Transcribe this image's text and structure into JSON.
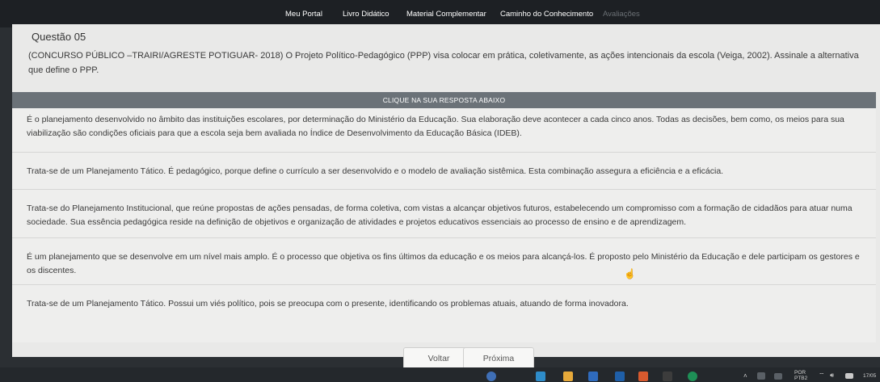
{
  "nav": {
    "items": [
      {
        "label": "Meu Portal"
      },
      {
        "label": "Livro Didático"
      },
      {
        "label": "Material Complementar"
      },
      {
        "label": "Caminho do Conhecimento"
      },
      {
        "label": "Avaliações"
      }
    ]
  },
  "question": {
    "title": "Questão 05",
    "text": "(CONCURSO PÚBLICO –TRAIRI/AGRESTE POTIGUAR- 2018) O Projeto Político-Pedagógico (PPP) visa colocar em prática, coletivamente, as ações intencionais da escola (Veiga, 2002). Assinale a alternativa que define o PPP."
  },
  "answers": {
    "header": "CLIQUE NA SUA RESPOSTA ABAIXO",
    "options": [
      {
        "text": "É o planejamento desenvolvido no âmbito das instituições escolares, por determinação do Ministério da Educação. Sua elaboração deve acontecer a cada cinco anos. Todas as decisões, bem como, os meios para sua viabilização são condições oficiais para que a escola seja bem avaliada no Índice de Desenvolvimento da Educação Básica (IDEB)."
      },
      {
        "text": "Trata-se de um Planejamento Tático. É pedagógico, porque define o currículo a ser desenvolvido e o modelo de avaliação sistêmica. Esta combinação assegura a eficiência e a eficácia."
      },
      {
        "text": "Trata-se do Planejamento Institucional, que reúne propostas de ações pensadas, de forma coletiva, com vistas a alcançar objetivos futuros, estabelecendo um compromisso com a formação de cidadãos para atuar numa sociedade. Sua essência pedagógica reside na definição de objetivos e organização de atividades e projetos educativos essenciais ao processo de ensino e de aprendizagem."
      },
      {
        "text": "É um planejamento que se desenvolve em um nível mais amplo. É o processo que objetiva os fins últimos da educação e os meios para alcançá-los. É proposto pelo Ministério da Educação e dele participam os gestores e os discentes."
      },
      {
        "text": "Trata-se de um Planejamento Tático. Possui um viés político, pois se preocupa com o presente, identificando os problemas atuais, atuando de forma inovadora."
      }
    ]
  },
  "buttons": {
    "prev": "Voltar",
    "next": "Próxima"
  },
  "taskbar": {
    "lang_top": "POR",
    "lang_bottom": "PTB2",
    "time": "17/05"
  },
  "colors": {
    "nav_bg": "#1d2024",
    "content_bg": "#e9e9e8",
    "answer_header_bg": "#6b7278",
    "taskbar_bg": "#24282c"
  }
}
